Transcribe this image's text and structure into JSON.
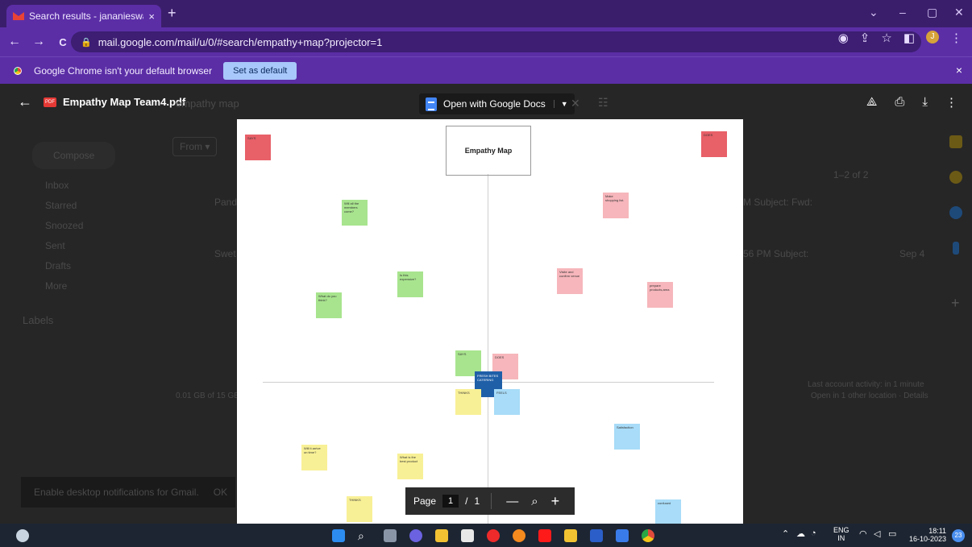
{
  "tab": {
    "title": "Search results - jananieswaranc",
    "close": "×",
    "new": "+"
  },
  "window_controls": {
    "collapse": "⌄",
    "minimize": "–",
    "restore": "▢",
    "close": "✕"
  },
  "toolbar": {
    "back": "←",
    "forward": "→",
    "reload": "C",
    "url": "mail.google.com/mail/u/0/#search/empathy+map?projector=1",
    "profile_initial": "J"
  },
  "infobar": {
    "message": "Google Chrome isn't your default browser",
    "set_default": "Set as default",
    "close": "×"
  },
  "viewer": {
    "back": "←",
    "file_badge": "PDF",
    "file_name": "Empathy Map Team4.pdf",
    "search_bg": "empathy map",
    "open_with": "Open with Google Docs",
    "close": "✕"
  },
  "gmail_bg": {
    "compose": "Compose",
    "from": "From ▾",
    "nav": [
      "Inbox",
      "Starred",
      "Snoozed",
      "Sent",
      "Drafts",
      "More"
    ],
    "labels": "Labels",
    "row1": "Pand",
    "row2": "Swet",
    "subj1": "M Subject: Fwd:",
    "subj2": "56 PM Subject:",
    "date": "Sep 4",
    "count": "1–2 of 2",
    "storage": "0.01 GB of 15 GB",
    "activity": "Last account activity: in 1 minute",
    "activity2": "Open in 1 other location · Details",
    "notif": "Enable desktop notifications for Gmail.",
    "notif_ok": "OK"
  },
  "pdf": {
    "title": "Empathy Map",
    "notes": {
      "says_corner": "SAYS",
      "does_corner": "DOES",
      "say1": "Will all the members come?",
      "say2": "Is this expensive?",
      "say3": "What do you think?",
      "do1": "Make shopping list.",
      "do2": "Visite and confirm venue",
      "do3": "prepare products,area",
      "says_center": "SAYS",
      "does_center": "DOES",
      "center": "FRESH BITES CATERING",
      "thinks_center": "THINKS",
      "feels_center": "FEELS",
      "feel1": "Satisfaction",
      "think1": "Will it arrive on time?",
      "think2": "What is the best product",
      "thinks_bottom": "THINKS",
      "feel2": "confused"
    }
  },
  "page_controls": {
    "label": "Page",
    "current": "1",
    "sep": "/",
    "total": "1",
    "zoom_out": "—",
    "zoom_in": "+"
  },
  "taskbar": {
    "lang": "ENG",
    "region": "IN",
    "time": "18:11",
    "date": "16-10-2023",
    "badge": "23"
  }
}
